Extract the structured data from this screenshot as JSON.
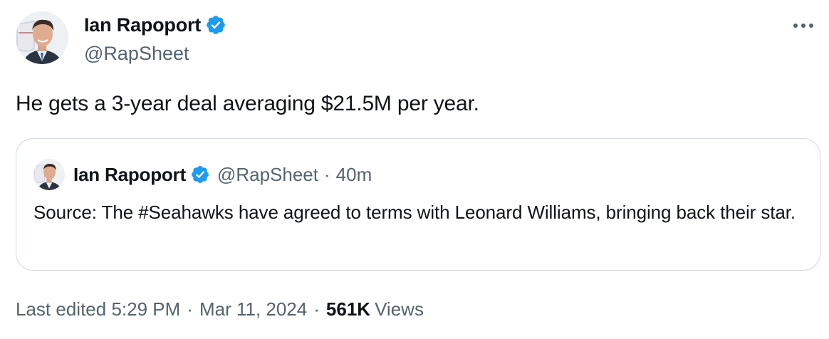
{
  "author": {
    "name": "Ian Rapoport",
    "handle": "@RapSheet",
    "verified": true
  },
  "icons": {
    "avatar": "avatar-icon",
    "verified": "verified-badge-icon",
    "more": "more-options-icon"
  },
  "tweet": {
    "text": "He gets a 3-year deal averaging $21.5M per year."
  },
  "quoted_tweet": {
    "name": "Ian Rapoport",
    "handle": "@RapSheet",
    "dot": "·",
    "time": "40m",
    "text": "Source: The #Seahawks have agreed to terms with Leonard Williams, bringing back their star."
  },
  "meta": {
    "edited_label": "Last edited",
    "time": "5:29 PM",
    "dot": "·",
    "date": "Mar 11, 2024",
    "views_count": "561K",
    "views_label": "Views"
  },
  "colors": {
    "text": "#0f1419",
    "secondary": "#536471",
    "verified_blue": "#1d9bf0",
    "border": "#cfd9de"
  }
}
